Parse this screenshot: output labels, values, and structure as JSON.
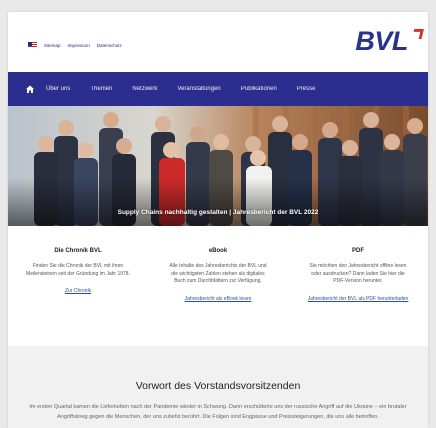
{
  "header": {
    "lang_items": [
      "Sitemap",
      "Impressum",
      "Datenschutz"
    ],
    "logo_text": "BVL"
  },
  "nav": {
    "items": [
      "Über uns",
      "Themen",
      "Netzwerk",
      "Veranstaltungen",
      "Publikationen",
      "Presse"
    ]
  },
  "hero": {
    "caption": "Supply Chains nachhaltig gestalten | Jahresbericht der BVL 2022"
  },
  "cards": [
    {
      "title": "Die Chronik BVL",
      "text": "Finden Sie die Chronik der BVL mit ihren Meilensteinen seit der Gründung im Jahr 1978.",
      "link": "Zur Chronik"
    },
    {
      "title": "eBook",
      "text": "Alle Inhalte des Jahresberichts der BVL und die wichtigsten Zahlen stehen als digitales Buch zum Durchblättern zur Verfügung.",
      "link": "Jahresbericht als eBook lesen"
    },
    {
      "title": "PDF",
      "text": "Sie möchten den Jahresbericht offline lesen oder ausdrucken? Dann laden Sie hier die PDF-Version herunter.",
      "link": "Jahresbericht der BVL als PDF herunterladen"
    }
  ],
  "foreword": {
    "title": "Vorwort des Vorstandsvorsitzenden",
    "text": "Im ersten Quartal kamen die Lieferketten nach der Pandemie wieder in Schwung. Dann erschütterte uns der russische Angriff auf die Ukraine – ein brutaler Angriffskrieg gegen die Menschen, der uns zutiefst berührt. Die Folgen sind Engpässe und Preissteigerungen, die uns alle betreffen."
  },
  "colors": {
    "brand": "#27348b",
    "nav_bg": "#2b2e8e",
    "logo_accent": "#d32f2f",
    "link": "#2b4fb0"
  },
  "icons": [
    "flag-icon",
    "home-icon"
  ]
}
